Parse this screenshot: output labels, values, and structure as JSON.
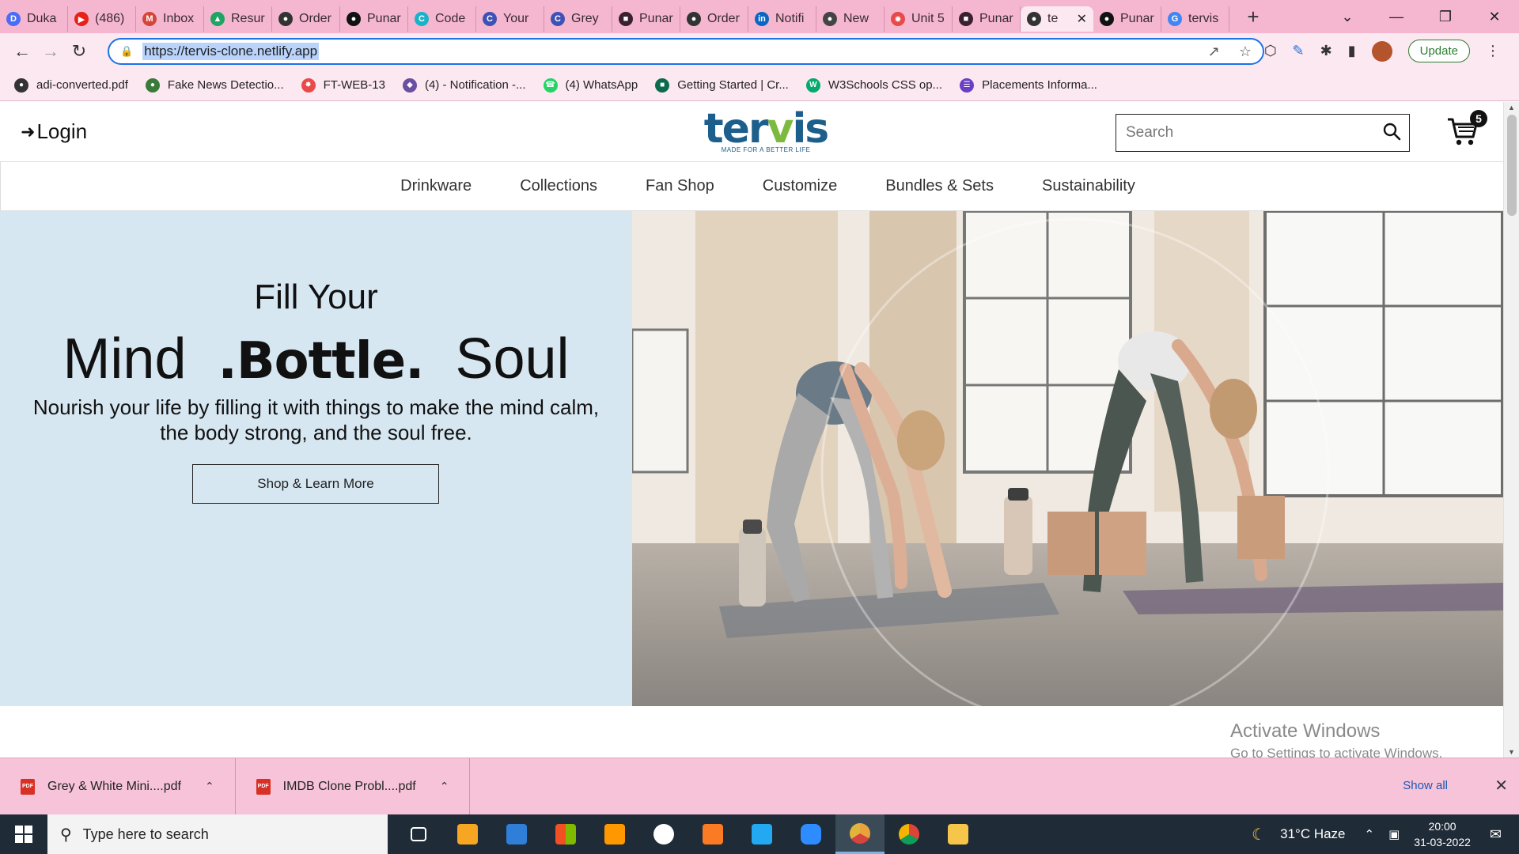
{
  "browser": {
    "tabs": [
      {
        "label": "Duka",
        "color": "#4a6cf7",
        "icon": "D"
      },
      {
        "label": "(486)",
        "color": "#e62117",
        "icon": "▶"
      },
      {
        "label": "Inbox",
        "color": "#d44638",
        "icon": "M"
      },
      {
        "label": "Resur",
        "color": "#1fa463",
        "icon": "▲"
      },
      {
        "label": "Order",
        "color": "#333333",
        "icon": "●"
      },
      {
        "label": "Punar",
        "color": "#111111",
        "icon": "●"
      },
      {
        "label": "Code",
        "color": "#18b3c8",
        "icon": "C"
      },
      {
        "label": "Your",
        "color": "#3f51b5",
        "icon": "C"
      },
      {
        "label": "Grey",
        "color": "#3f51b5",
        "icon": "C"
      },
      {
        "label": "Punar",
        "color": "#3a2030",
        "icon": "■"
      },
      {
        "label": "Order",
        "color": "#333333",
        "icon": "●"
      },
      {
        "label": "Notifi",
        "color": "#0a66c2",
        "icon": "in"
      },
      {
        "label": "New",
        "color": "#444444",
        "icon": "●"
      },
      {
        "label": "Unit 5",
        "color": "#e84a4a",
        "icon": "✸"
      },
      {
        "label": "Punar",
        "color": "#3a2030",
        "icon": "■"
      },
      {
        "label": "te",
        "color": "#333333",
        "icon": "●",
        "active": true
      },
      {
        "label": "Punar",
        "color": "#111111",
        "icon": "●"
      },
      {
        "label": "tervis",
        "color": "#4285f4",
        "icon": "G"
      }
    ],
    "url": "https://tervis-clone.netlify.app",
    "update_label": "Update",
    "bookmarks": [
      {
        "label": "adi-converted.pdf",
        "color": "#333333",
        "icon": "●"
      },
      {
        "label": "Fake News Detectio...",
        "color": "#3a7a3a",
        "icon": "●"
      },
      {
        "label": "FT-WEB-13",
        "color": "#e84a4a",
        "icon": "✸"
      },
      {
        "label": "(4) - Notification -...",
        "color": "#6a4fa3",
        "icon": "◆"
      },
      {
        "label": "(4) WhatsApp",
        "color": "#25d366",
        "icon": "☎"
      },
      {
        "label": "Getting Started | Cr...",
        "color": "#0c6b4f",
        "icon": "■"
      },
      {
        "label": "W3Schools CSS op...",
        "color": "#04aa6d",
        "icon": "W"
      },
      {
        "label": "Placements Informa...",
        "color": "#6a3fc4",
        "icon": "☰"
      }
    ]
  },
  "site": {
    "login": "Login",
    "logo_word_a": "ter",
    "logo_word_b": "v",
    "logo_word_c": "is",
    "logo_tagline": "MADE FOR A BETTER LIFE",
    "search_placeholder": "Search",
    "cart_count": "5",
    "nav": [
      "Drinkware",
      "Collections",
      "Fan Shop",
      "Customize",
      "Bundles & Sets",
      "Sustainability"
    ],
    "hero": {
      "line1": "Fill Your",
      "line2_a": "Mind",
      "line2_b": ".Bottle.",
      "line2_c": "Soul",
      "body": "Nourish your life by filling it with things to make the mind calm, the body strong, and the soul free.",
      "cta": "Shop & Learn More"
    }
  },
  "watermark": {
    "title": "Activate Windows",
    "subtitle": "Go to Settings to activate Windows."
  },
  "downloads": {
    "items": [
      "Grey & White Mini....pdf",
      "IMDB Clone Probl....pdf"
    ],
    "show_all": "Show all"
  },
  "taskbar": {
    "search_placeholder": "Type here to search",
    "weather": "31°C  Haze",
    "time": "20:00",
    "date": "31-03-2022"
  }
}
